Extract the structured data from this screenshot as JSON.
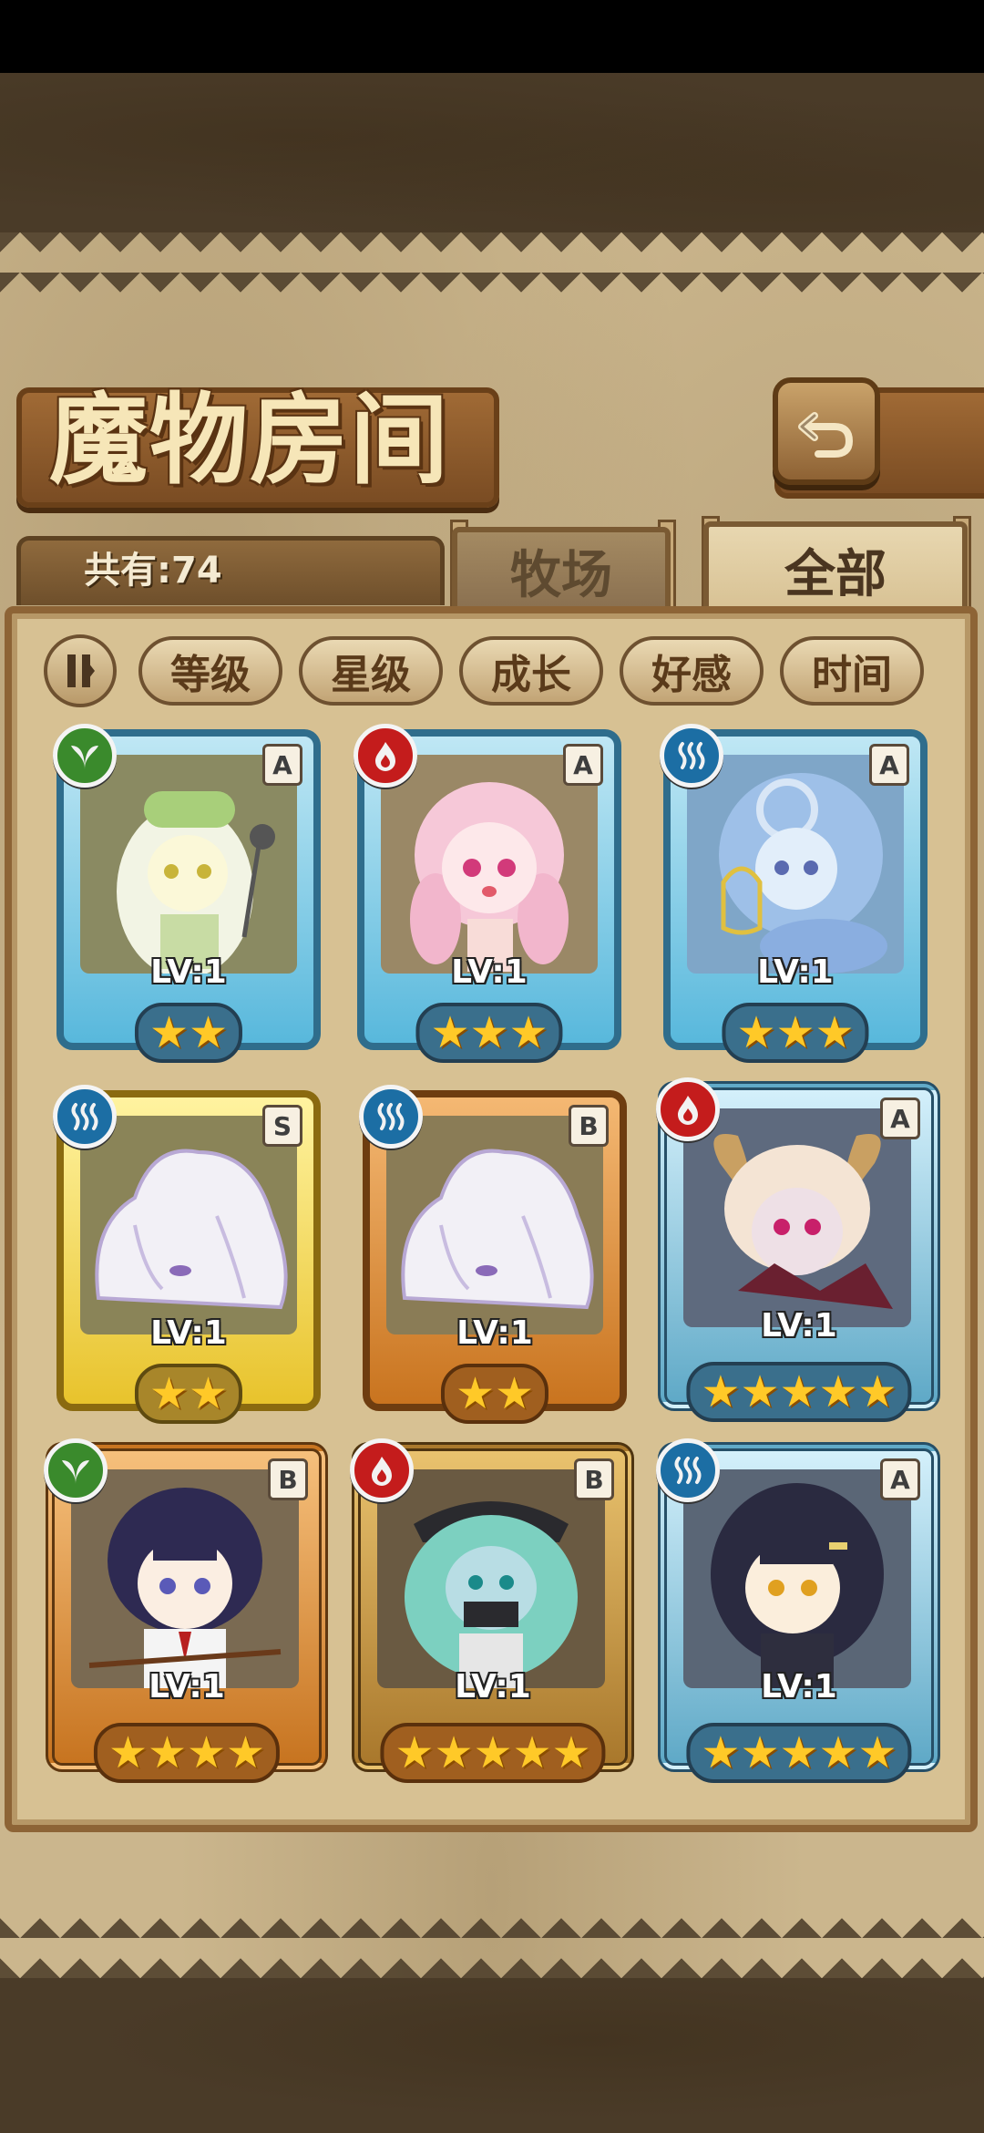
{
  "title": "魔物房间",
  "count_label": "共有:74",
  "tabs": {
    "farm": "牧场",
    "all": "全部",
    "active": "全部"
  },
  "filters": [
    "等级",
    "星级",
    "成长",
    "好感",
    "时间"
  ],
  "monsters": [
    {
      "name": "radish-girl",
      "element": "wood",
      "rank": "A",
      "level": "LV:1",
      "stars": "★★",
      "frame": "blue"
    },
    {
      "name": "pink-curly-girl",
      "element": "fire",
      "rank": "A",
      "level": "LV:1",
      "stars": "★★★",
      "frame": "blue"
    },
    {
      "name": "blue-mermaid",
      "element": "water",
      "rank": "A",
      "level": "LV:1",
      "stars": "★★★",
      "frame": "blue"
    },
    {
      "name": "white-slime-s",
      "element": "water",
      "rank": "S",
      "level": "LV:1",
      "stars": "★★",
      "frame": "yellow"
    },
    {
      "name": "white-slime-b",
      "element": "water",
      "rank": "B",
      "level": "LV:1",
      "stars": "★★",
      "frame": "orange"
    },
    {
      "name": "horned-demon-girl",
      "element": "fire",
      "rank": "A",
      "level": "LV:1",
      "stars": "★★★★★",
      "frame": "ornate-blue"
    },
    {
      "name": "dark-hair-boy",
      "element": "wood",
      "rank": "B",
      "level": "LV:1",
      "stars": "★★★★",
      "frame": "ornate-orange"
    },
    {
      "name": "pirate-captain",
      "element": "fire",
      "rank": "B",
      "level": "LV:1",
      "stars": "★★★★★",
      "frame": "ornate-gold"
    },
    {
      "name": "black-hair-girl",
      "element": "water",
      "rank": "A",
      "level": "LV:1",
      "stars": "★★★★★",
      "frame": "ornate-blue"
    }
  ],
  "colors": {
    "wood": "#3a8a2c",
    "fire": "#c41c1c",
    "water": "#1c6ea4",
    "star": "#ffc928"
  },
  "icons": {
    "back": "return-arrow-icon",
    "filter_toggle": "pause-toggle-icon",
    "wood": "leaf-icon",
    "fire": "flame-icon",
    "water": "waves-icon"
  }
}
